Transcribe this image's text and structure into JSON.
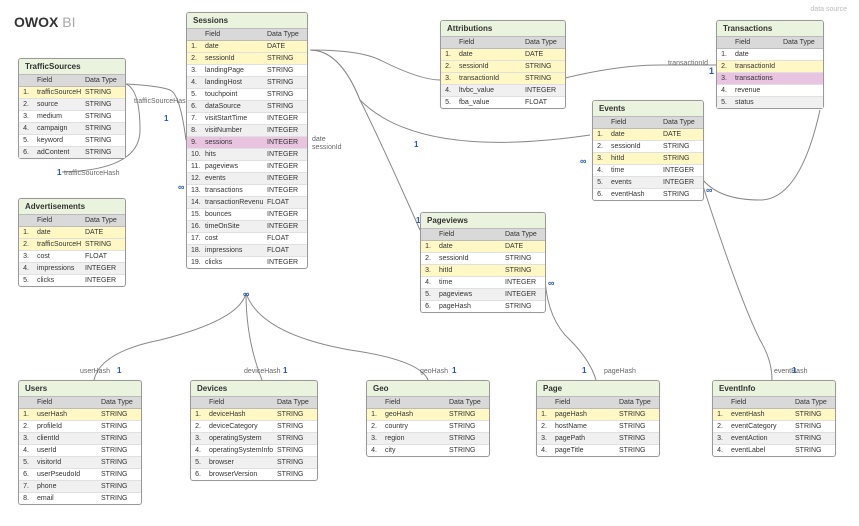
{
  "logo": {
    "brand": "OWOX",
    "suffix": " BI"
  },
  "header_link": "data source",
  "hdr": {
    "num": "",
    "field": "Field",
    "type": "Data Type"
  },
  "labels": {
    "trafficSourceHash": "trafficSourceHash",
    "date": "date",
    "sessionId": "sessionId",
    "transactionId": "transactionId",
    "userHash": "userHash",
    "deviceHash": "deviceHash",
    "geoHash": "geoHash",
    "pageHash": "pageHash",
    "eventHash": "eventHash"
  },
  "card": {
    "one": "1",
    "many": "∞"
  },
  "tables": {
    "trafficSources": {
      "title": "TrafficSources",
      "rows": [
        {
          "n": "1.",
          "f": "trafficSourceHash",
          "t": "STRING",
          "cls": "k"
        },
        {
          "n": "2.",
          "f": "source",
          "t": "STRING",
          "cls": "a"
        },
        {
          "n": "3.",
          "f": "medium",
          "t": "STRING",
          "cls": ""
        },
        {
          "n": "4.",
          "f": "campaign",
          "t": "STRING",
          "cls": "a"
        },
        {
          "n": "5.",
          "f": "keyword",
          "t": "STRING",
          "cls": ""
        },
        {
          "n": "6.",
          "f": "adContent",
          "t": "STRING",
          "cls": "a"
        }
      ]
    },
    "advertisements": {
      "title": "Advertisements",
      "rows": [
        {
          "n": "1.",
          "f": "date",
          "t": "DATE",
          "cls": "k"
        },
        {
          "n": "2.",
          "f": "trafficSourceHash",
          "t": "STRING",
          "cls": "k"
        },
        {
          "n": "3.",
          "f": "cost",
          "t": "FLOAT",
          "cls": ""
        },
        {
          "n": "4.",
          "f": "impressions",
          "t": "INTEGER",
          "cls": "a"
        },
        {
          "n": "5.",
          "f": "clicks",
          "t": "INTEGER",
          "cls": ""
        }
      ]
    },
    "sessions": {
      "title": "Sessions",
      "rows": [
        {
          "n": "1.",
          "f": "date",
          "t": "DATE",
          "cls": "k"
        },
        {
          "n": "2.",
          "f": "sessionId",
          "t": "STRING",
          "cls": "k"
        },
        {
          "n": "3.",
          "f": "landingPage",
          "t": "STRING",
          "cls": ""
        },
        {
          "n": "4.",
          "f": "landingHost",
          "t": "STRING",
          "cls": "a"
        },
        {
          "n": "5.",
          "f": "touchpoint",
          "t": "STRING",
          "cls": ""
        },
        {
          "n": "6.",
          "f": "dataSource",
          "t": "STRING",
          "cls": "a"
        },
        {
          "n": "7.",
          "f": "visitStartTime",
          "t": "INTEGER",
          "cls": ""
        },
        {
          "n": "8.",
          "f": "visitNumber",
          "t": "INTEGER",
          "cls": "a"
        },
        {
          "n": "9.",
          "f": "sessions",
          "t": "INTEGER",
          "cls": "p"
        },
        {
          "n": "10.",
          "f": "hits",
          "t": "INTEGER",
          "cls": "a"
        },
        {
          "n": "11.",
          "f": "pageviews",
          "t": "INTEGER",
          "cls": ""
        },
        {
          "n": "12.",
          "f": "events",
          "t": "INTEGER",
          "cls": "a"
        },
        {
          "n": "13.",
          "f": "transactions",
          "t": "INTEGER",
          "cls": ""
        },
        {
          "n": "14.",
          "f": "transactionRevenue",
          "t": "FLOAT",
          "cls": "a"
        },
        {
          "n": "15.",
          "f": "bounces",
          "t": "INTEGER",
          "cls": ""
        },
        {
          "n": "16.",
          "f": "timeOnSite",
          "t": "INTEGER",
          "cls": "a"
        },
        {
          "n": "17.",
          "f": "cost",
          "t": "FLOAT",
          "cls": ""
        },
        {
          "n": "18.",
          "f": "impressions",
          "t": "FLOAT",
          "cls": "a"
        },
        {
          "n": "19.",
          "f": "clicks",
          "t": "INTEGER",
          "cls": ""
        }
      ]
    },
    "attributions": {
      "title": "Attributions",
      "rows": [
        {
          "n": "1.",
          "f": "date",
          "t": "DATE",
          "cls": "k"
        },
        {
          "n": "2.",
          "f": "sessionId",
          "t": "STRING",
          "cls": "k"
        },
        {
          "n": "3.",
          "f": "transactionId",
          "t": "STRING",
          "cls": "k"
        },
        {
          "n": "4.",
          "f": "ltvbc_value",
          "t": "INTEGER",
          "cls": "a"
        },
        {
          "n": "5.",
          "f": "fba_value",
          "t": "FLOAT",
          "cls": ""
        }
      ]
    },
    "transactions": {
      "title": "Transactions",
      "rows": [
        {
          "n": "1.",
          "f": "date",
          "t": "",
          "cls": ""
        },
        {
          "n": "2.",
          "f": "transactionId",
          "t": "",
          "cls": "k"
        },
        {
          "n": "3.",
          "f": "transactions",
          "t": "",
          "cls": "p"
        },
        {
          "n": "4.",
          "f": "revenue",
          "t": "",
          "cls": ""
        },
        {
          "n": "5.",
          "f": "status",
          "t": "",
          "cls": "a"
        }
      ]
    },
    "events": {
      "title": "Events",
      "rows": [
        {
          "n": "1.",
          "f": "date",
          "t": "DATE",
          "cls": "k"
        },
        {
          "n": "2.",
          "f": "sessionId",
          "t": "STRING",
          "cls": ""
        },
        {
          "n": "3.",
          "f": "hitId",
          "t": "STRING",
          "cls": "k"
        },
        {
          "n": "4.",
          "f": "time",
          "t": "INTEGER",
          "cls": ""
        },
        {
          "n": "5.",
          "f": "events",
          "t": "INTEGER",
          "cls": "a"
        },
        {
          "n": "6.",
          "f": "eventHash",
          "t": "STRING",
          "cls": ""
        }
      ]
    },
    "pageviews": {
      "title": "Pageviews",
      "rows": [
        {
          "n": "1.",
          "f": "date",
          "t": "DATE",
          "cls": "k"
        },
        {
          "n": "2.",
          "f": "sessionId",
          "t": "STRING",
          "cls": ""
        },
        {
          "n": "3.",
          "f": "hitId",
          "t": "STRING",
          "cls": "k"
        },
        {
          "n": "4.",
          "f": "time",
          "t": "INTEGER",
          "cls": ""
        },
        {
          "n": "5.",
          "f": "pageviews",
          "t": "INTEGER",
          "cls": "a"
        },
        {
          "n": "6.",
          "f": "pageHash",
          "t": "STRING",
          "cls": ""
        }
      ]
    },
    "users": {
      "title": "Users",
      "rows": [
        {
          "n": "1.",
          "f": "userHash",
          "t": "STRING",
          "cls": "k"
        },
        {
          "n": "2.",
          "f": "profileId",
          "t": "STRING",
          "cls": ""
        },
        {
          "n": "3.",
          "f": "clientId",
          "t": "STRING",
          "cls": "a"
        },
        {
          "n": "4.",
          "f": "userId",
          "t": "STRING",
          "cls": ""
        },
        {
          "n": "5.",
          "f": "visitorId",
          "t": "STRING",
          "cls": "a"
        },
        {
          "n": "6.",
          "f": "userPseudoId",
          "t": "STRING",
          "cls": ""
        },
        {
          "n": "7.",
          "f": "phone",
          "t": "STRING",
          "cls": "a"
        },
        {
          "n": "8.",
          "f": "email",
          "t": "STRING",
          "cls": ""
        }
      ]
    },
    "devices": {
      "title": "Devices",
      "rows": [
        {
          "n": "1.",
          "f": "deviceHash",
          "t": "STRING",
          "cls": "k"
        },
        {
          "n": "2.",
          "f": "deviceCategory",
          "t": "STRING",
          "cls": ""
        },
        {
          "n": "3.",
          "f": "operatingSystem",
          "t": "STRING",
          "cls": "a"
        },
        {
          "n": "4.",
          "f": "operatingSystemInfo",
          "t": "STRING",
          "cls": ""
        },
        {
          "n": "5.",
          "f": "browser",
          "t": "STRING",
          "cls": "a"
        },
        {
          "n": "6.",
          "f": "browserVersion",
          "t": "STRING",
          "cls": ""
        }
      ]
    },
    "geo": {
      "title": "Geo",
      "rows": [
        {
          "n": "1.",
          "f": "geoHash",
          "t": "STRING",
          "cls": "k"
        },
        {
          "n": "2.",
          "f": "country",
          "t": "STRING",
          "cls": ""
        },
        {
          "n": "3.",
          "f": "region",
          "t": "STRING",
          "cls": "a"
        },
        {
          "n": "4.",
          "f": "city",
          "t": "STRING",
          "cls": ""
        }
      ]
    },
    "page": {
      "title": "Page",
      "rows": [
        {
          "n": "1.",
          "f": "pageHash",
          "t": "STRING",
          "cls": "k"
        },
        {
          "n": "2.",
          "f": "hostName",
          "t": "STRING",
          "cls": ""
        },
        {
          "n": "3.",
          "f": "pagePath",
          "t": "STRING",
          "cls": "a"
        },
        {
          "n": "4.",
          "f": "pageTitle",
          "t": "STRING",
          "cls": ""
        }
      ]
    },
    "eventInfo": {
      "title": "EventInfo",
      "rows": [
        {
          "n": "1.",
          "f": "eventHash",
          "t": "STRING",
          "cls": "k"
        },
        {
          "n": "2.",
          "f": "eventCategory",
          "t": "STRING",
          "cls": ""
        },
        {
          "n": "3.",
          "f": "eventAction",
          "t": "STRING",
          "cls": "a"
        },
        {
          "n": "4.",
          "f": "eventLabel",
          "t": "STRING",
          "cls": ""
        }
      ]
    }
  }
}
